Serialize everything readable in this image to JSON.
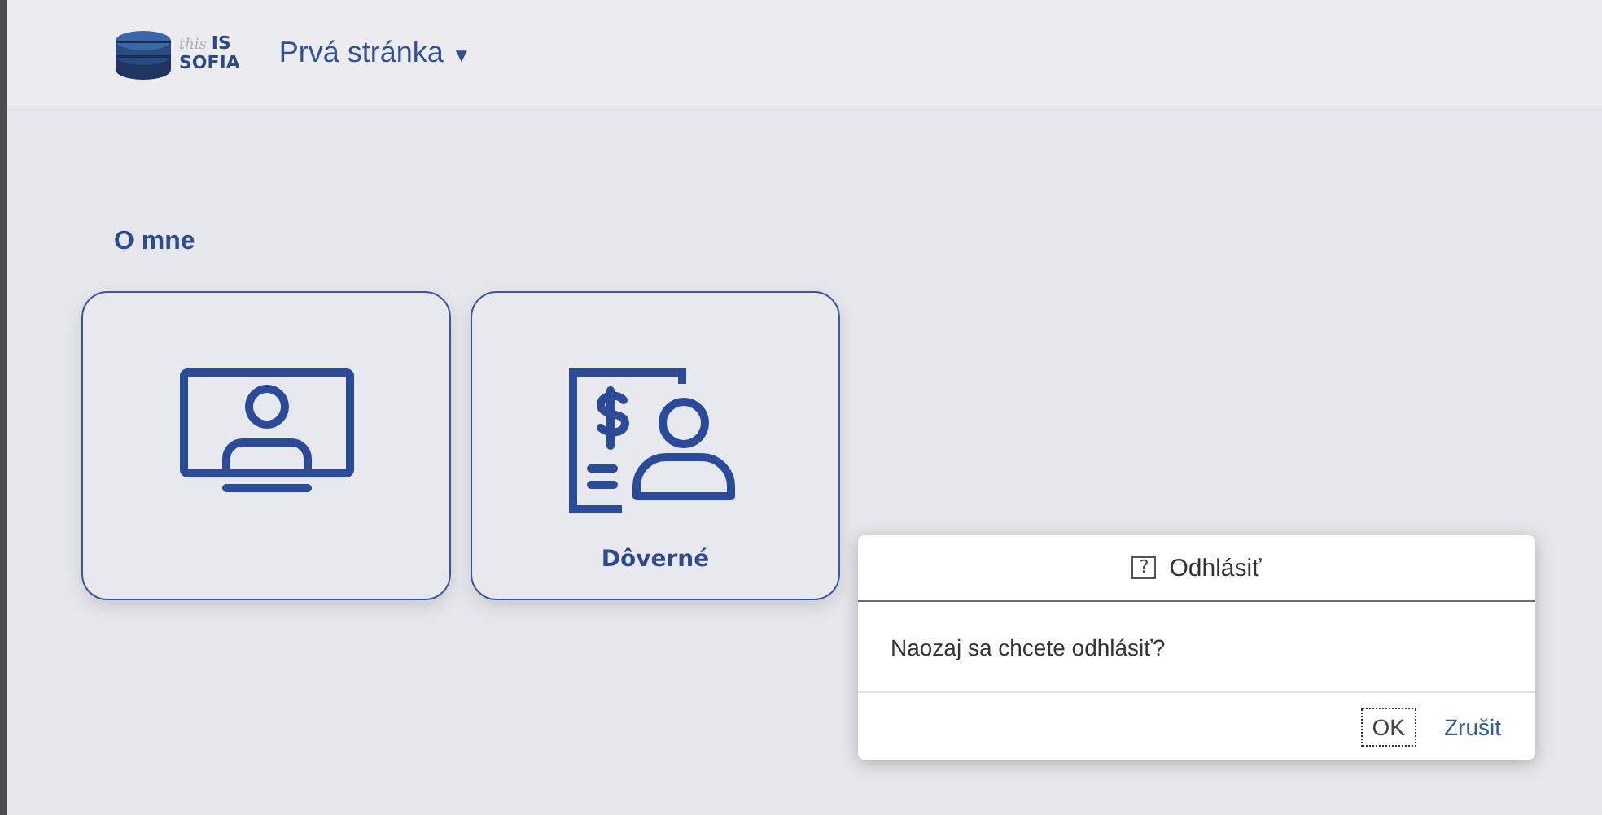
{
  "header": {
    "logo": {
      "small": "this",
      "top": "IS",
      "bottom": "SOFIA"
    },
    "title": "Prvá stránka",
    "title_caret": "▼"
  },
  "section": {
    "title": "O mne"
  },
  "tiles": [
    {
      "kind": "monitor-person"
    },
    {
      "kind": "document-person",
      "label": "Dôverné"
    }
  ],
  "dialog": {
    "icon": "?",
    "title": "Odhlásiť",
    "message": "Naozaj sa chcete odhlásiť?",
    "buttons": [
      {
        "label": "OK",
        "focused": true
      },
      {
        "label": "Zrušit",
        "focused": false
      }
    ]
  }
}
